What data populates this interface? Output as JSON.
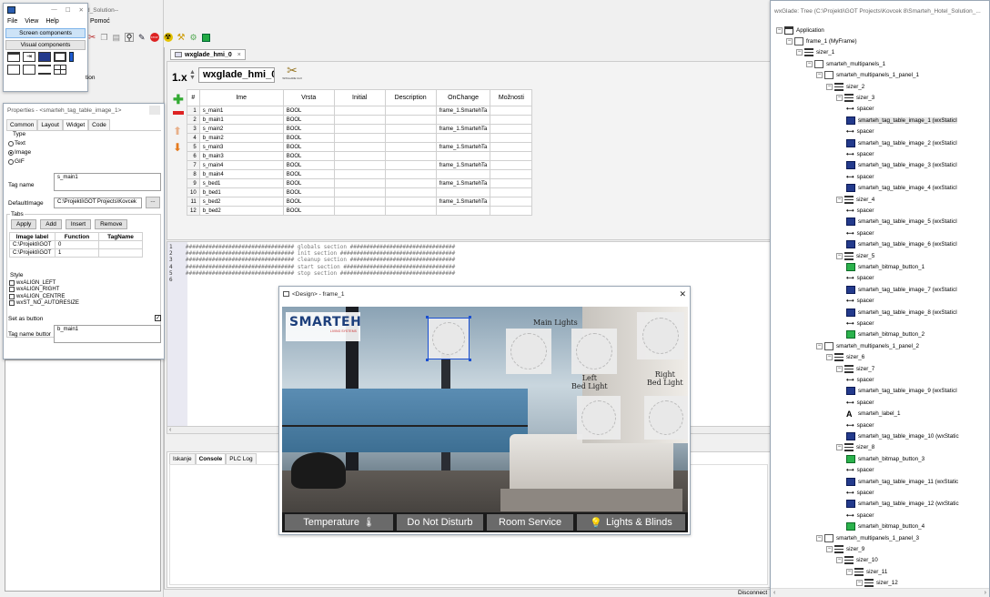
{
  "topleft_window": {
    "title_frag": "d_Solution--",
    "menu": [
      "File",
      "View",
      "Help"
    ],
    "menu_extra": "Pomoć",
    "screen_components": "Screen components",
    "visual_components": "Visual components"
  },
  "toolbar_icons": [
    "cut-icon",
    "copy-icon",
    "paste-icon",
    "find-icon",
    "pencil-icon",
    "stop-icon",
    "radiation-icon",
    "brush-icon",
    "settings-icon",
    "chip-icon"
  ],
  "editor_tab": "wxglade_hmi_0",
  "editor_header": {
    "version": "1.x",
    "name": "wxglade_hmi_0",
    "logo_caption": "WXGLADE GUI"
  },
  "grid": {
    "columns": [
      "#",
      "Ime",
      "Vrsta",
      "Initial",
      "Description",
      "OnChange",
      "Možnosti"
    ],
    "rows": [
      [
        "1",
        "s_main1",
        "BOOL",
        "",
        "",
        "frame_1.SmartehTa",
        ""
      ],
      [
        "2",
        "b_main1",
        "BOOL",
        "",
        "",
        "",
        ""
      ],
      [
        "3",
        "s_main2",
        "BOOL",
        "",
        "",
        "frame_1.SmartehTa",
        ""
      ],
      [
        "4",
        "b_main2",
        "BOOL",
        "",
        "",
        "",
        ""
      ],
      [
        "5",
        "s_main3",
        "BOOL",
        "",
        "",
        "frame_1.SmartehTa",
        ""
      ],
      [
        "6",
        "b_main3",
        "BOOL",
        "",
        "",
        "",
        ""
      ],
      [
        "7",
        "s_main4",
        "BOOL",
        "",
        "",
        "frame_1.SmartehTa",
        ""
      ],
      [
        "8",
        "b_main4",
        "BOOL",
        "",
        "",
        "",
        ""
      ],
      [
        "9",
        "s_bed1",
        "BOOL",
        "",
        "",
        "frame_1.SmartehTa",
        ""
      ],
      [
        "10",
        "b_bed1",
        "BOOL",
        "",
        "",
        "",
        ""
      ],
      [
        "11",
        "s_bed2",
        "BOOL",
        "",
        "",
        "frame_1.SmartehTa",
        ""
      ],
      [
        "12",
        "b_bed2",
        "BOOL",
        "",
        "",
        "",
        ""
      ]
    ]
  },
  "code_lines": [
    {
      "n": "1",
      "t": "################################# globals section ################################"
    },
    {
      "n": "2",
      "t": "################################# init section ###################################"
    },
    {
      "n": "3",
      "t": "################################# cleanup section ################################"
    },
    {
      "n": "4",
      "t": "################################# start section ##################################"
    },
    {
      "n": "5",
      "t": "################################# stop section ###################################"
    },
    {
      "n": "6",
      "t": ""
    }
  ],
  "bottom_tabs": [
    "Iskanje",
    "Console",
    "PLC Log"
  ],
  "status": "Disconnect",
  "properties": {
    "title": "Properties - <smarteh_tag_table_image_1>",
    "tabs": [
      "Common",
      "Layout",
      "Widget",
      "Code"
    ],
    "type_label": "Type",
    "radios": [
      "Text",
      "Image",
      "GIF"
    ],
    "tag_name_label": "Tag name",
    "tag_name_value": "s_main1",
    "default_image_label": "DefaultImage",
    "default_image_value": "C:\\Projekti\\GOT Projects\\Kovcek",
    "browse": "...",
    "tabs_label": "Tabs",
    "buttons": [
      "Apply",
      "Add",
      "Insert",
      "Remove"
    ],
    "table_cols": [
      "Image label",
      "Function",
      "TagName"
    ],
    "table_rows": [
      [
        "C:\\Projekti\\GOT",
        "0",
        ""
      ],
      [
        "C:\\Projekti\\GOT",
        "1",
        ""
      ]
    ],
    "style_label": "Style",
    "styles": [
      "wxALIGN_LEFT",
      "wxALIGN_RIGHT",
      "wxALIGN_CENTRE",
      "wxST_NO_AUTORESIZE"
    ],
    "set_as_button": "Set as button",
    "tag_name_button_label": "Tag name buttor",
    "tag_name_button_value": "b_main1",
    "side_label": "tion"
  },
  "design": {
    "title": "<Design> - frame_1",
    "logo": "SMARTEH",
    "logo_sub": "LIVING SYSTEMS",
    "labels": {
      "main": "Main Lights",
      "left": "Left\nBed Light",
      "right": "Right\nBed Light"
    },
    "buttons": [
      "Temperature",
      "Do Not Disturb",
      "Room Service",
      "Lights & Blinds"
    ]
  },
  "tree": {
    "title": "wxGlade: Tree (C:\\Projekti\\GOT Projects\\Kovcek 8\\Smarteh_Hotel_Solution_...",
    "items": [
      {
        "d": 0,
        "i": "app",
        "t": "Application"
      },
      {
        "d": 1,
        "i": "frame",
        "t": "frame_1 (MyFrame)"
      },
      {
        "d": 2,
        "i": "sizer",
        "t": "sizer_1"
      },
      {
        "d": 3,
        "i": "panel",
        "t": "smarteh_multipanels_1"
      },
      {
        "d": 4,
        "i": "panel",
        "t": "smarteh_multipanels_1_panel_1"
      },
      {
        "d": 5,
        "i": "sizer",
        "t": "sizer_2"
      },
      {
        "d": 6,
        "i": "sizer",
        "t": "sizer_3"
      },
      {
        "d": 7,
        "i": "spacer",
        "t": "spacer"
      },
      {
        "d": 7,
        "i": "img",
        "t": "smarteh_tag_table_image_1 (wxStaticI"
      },
      {
        "d": 7,
        "i": "spacer",
        "t": "spacer"
      },
      {
        "d": 7,
        "i": "img",
        "t": "smarteh_tag_table_image_2 (wxStaticI"
      },
      {
        "d": 7,
        "i": "spacer",
        "t": "spacer"
      },
      {
        "d": 7,
        "i": "img",
        "t": "smarteh_tag_table_image_3 (wxStaticI"
      },
      {
        "d": 7,
        "i": "spacer",
        "t": "spacer"
      },
      {
        "d": 7,
        "i": "img",
        "t": "smarteh_tag_table_image_4 (wxStaticI"
      },
      {
        "d": 6,
        "i": "sizer",
        "t": "sizer_4"
      },
      {
        "d": 7,
        "i": "spacer",
        "t": "spacer"
      },
      {
        "d": 7,
        "i": "img",
        "t": "smarteh_tag_table_image_5 (wxStaticI"
      },
      {
        "d": 7,
        "i": "spacer",
        "t": "spacer"
      },
      {
        "d": 7,
        "i": "img",
        "t": "smarteh_tag_table_image_6 (wxStaticI"
      },
      {
        "d": 6,
        "i": "sizer",
        "t": "sizer_5"
      },
      {
        "d": 7,
        "i": "bmp",
        "t": "smarteh_bitmap_button_1"
      },
      {
        "d": 7,
        "i": "spacer",
        "t": "spacer"
      },
      {
        "d": 7,
        "i": "img",
        "t": "smarteh_tag_table_image_7 (wxStaticI"
      },
      {
        "d": 7,
        "i": "spacer",
        "t": "spacer"
      },
      {
        "d": 7,
        "i": "img",
        "t": "smarteh_tag_table_image_8 (wxStaticI"
      },
      {
        "d": 7,
        "i": "spacer",
        "t": "spacer"
      },
      {
        "d": 7,
        "i": "bmp",
        "t": "smarteh_bitmap_button_2"
      },
      {
        "d": 4,
        "i": "panel",
        "t": "smarteh_multipanels_1_panel_2"
      },
      {
        "d": 5,
        "i": "sizer",
        "t": "sizer_6"
      },
      {
        "d": 6,
        "i": "sizer",
        "t": "sizer_7"
      },
      {
        "d": 7,
        "i": "spacer",
        "t": "spacer"
      },
      {
        "d": 7,
        "i": "img",
        "t": "smarteh_tag_table_image_9 (wxStaticI"
      },
      {
        "d": 7,
        "i": "spacer",
        "t": "spacer"
      },
      {
        "d": 7,
        "i": "label",
        "t": "smarteh_label_1"
      },
      {
        "d": 7,
        "i": "spacer",
        "t": "spacer"
      },
      {
        "d": 7,
        "i": "img",
        "t": "smarteh_tag_table_image_10 (wxStatic"
      },
      {
        "d": 6,
        "i": "sizer",
        "t": "sizer_8"
      },
      {
        "d": 7,
        "i": "bmp",
        "t": "smarteh_bitmap_button_3"
      },
      {
        "d": 7,
        "i": "spacer",
        "t": "spacer"
      },
      {
        "d": 7,
        "i": "img",
        "t": "smarteh_tag_table_image_11 (wxStatic"
      },
      {
        "d": 7,
        "i": "spacer",
        "t": "spacer"
      },
      {
        "d": 7,
        "i": "img",
        "t": "smarteh_tag_table_image_12 (wxStatic"
      },
      {
        "d": 7,
        "i": "spacer",
        "t": "spacer"
      },
      {
        "d": 7,
        "i": "bmp",
        "t": "smarteh_bitmap_button_4"
      },
      {
        "d": 4,
        "i": "panel",
        "t": "smarteh_multipanels_1_panel_3"
      },
      {
        "d": 5,
        "i": "sizer",
        "t": "sizer_9"
      },
      {
        "d": 6,
        "i": "sizer",
        "t": "sizer_10"
      },
      {
        "d": 7,
        "i": "sizer",
        "t": "sizer_11"
      },
      {
        "d": 8,
        "i": "sizer",
        "t": "sizer_12"
      }
    ]
  }
}
